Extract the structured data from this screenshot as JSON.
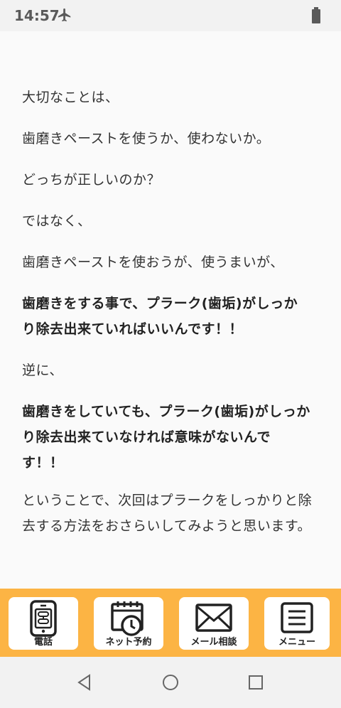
{
  "status_bar": {
    "time": "14:57"
  },
  "content": {
    "paragraphs": [
      {
        "text": "大切なことは、",
        "bold": false
      },
      {
        "text": "歯磨きペーストを使うか、使わないか。",
        "bold": false
      },
      {
        "text": "どっちが正しいのか？",
        "bold": false
      },
      {
        "text": "ではなく、",
        "bold": false
      },
      {
        "text": "歯磨きペーストを使おうが、使うまいが、",
        "bold": false
      },
      {
        "text": "歯磨きをする事で、プラーク(歯垢)がしっかり除去出来ていればいいんです！！",
        "bold": true
      },
      {
        "text": "逆に、",
        "bold": false
      },
      {
        "text": "歯磨きをしていても、プラーク(歯垢)がしっかり除去出来ていなければ意味がないんです！！",
        "bold": true
      },
      {
        "text": "ということで、次回はプラークをしっかりと除去する方法をおさらいしてみようと思います。",
        "bold": false
      }
    ]
  },
  "bottom_nav": {
    "background": "#fcb444",
    "items": [
      {
        "label": "電話",
        "icon": "phone-icon"
      },
      {
        "label": "ネット予約",
        "icon": "calendar-clock-icon"
      },
      {
        "label": "メール相談",
        "icon": "mail-icon"
      },
      {
        "label": "メニュー",
        "icon": "menu-icon"
      }
    ]
  }
}
